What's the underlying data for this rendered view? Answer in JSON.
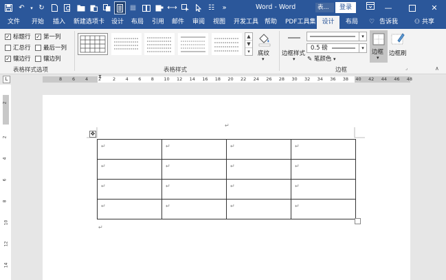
{
  "titlebar": {
    "doc_title": "Word - Word",
    "user_label": "表...",
    "login_label": "登录",
    "qat_icons": [
      "save-icon",
      "undo-icon",
      "redo-icon",
      "new-doc-icon",
      "print-preview-icon",
      "open-icon",
      "paste-icon",
      "copy-format-icon",
      "page-view-icon",
      "grid-icon",
      "table-icon",
      "clipboard-icon",
      "spacing-icon",
      "cursor-icon",
      "select-icon",
      "list-icon",
      "more-icon"
    ]
  },
  "tabs": [
    "文件",
    "开始",
    "插入",
    "新建选项卡",
    "设计",
    "布局",
    "引用",
    "邮件",
    "审阅",
    "视图",
    "开发工具",
    "帮助",
    "PDF工具集",
    "设计",
    "布局"
  ],
  "tellme_label": "告诉我",
  "share_label": "共享",
  "ribbon": {
    "style_options": {
      "items": [
        {
          "label": "标题行",
          "checked": true
        },
        {
          "label": "第一列",
          "checked": true
        },
        {
          "label": "汇总行",
          "checked": false
        },
        {
          "label": "最后一列",
          "checked": false
        },
        {
          "label": "镶边行",
          "checked": true
        },
        {
          "label": "镶边列",
          "checked": false
        }
      ],
      "group_label": "表格样式选项"
    },
    "table_styles": {
      "group_label": "表格样式",
      "shading_label": "底纹"
    },
    "borders": {
      "group_label": "边框",
      "border_styles_label": "边框样式",
      "line_weight_value": "0.5 磅",
      "pen_color_label": "笔颜色",
      "borders_label": "边框",
      "border_painter_label": "边框刷"
    }
  },
  "ruler": {
    "h_numbers": [
      "8",
      "6",
      "4",
      "2",
      "2",
      "4",
      "6",
      "8",
      "10",
      "12",
      "14",
      "16",
      "18",
      "20",
      "22",
      "24",
      "26",
      "28",
      "30",
      "32",
      "34",
      "36",
      "38",
      "40",
      "42",
      "44",
      "46",
      "48"
    ],
    "v_numbers": [
      "2",
      "2",
      "4",
      "6",
      "8",
      "10",
      "12",
      "14"
    ]
  },
  "document": {
    "paragraph_mark": "↵",
    "table": {
      "rows": [
        [
          "↵",
          "↵",
          "↵",
          "↵"
        ],
        [
          "↵",
          "↵",
          "↵",
          "↵"
        ],
        [
          "↵",
          "↵",
          "↵",
          "↵"
        ],
        [
          "↵",
          "↵",
          "↵",
          "↵"
        ]
      ]
    }
  }
}
